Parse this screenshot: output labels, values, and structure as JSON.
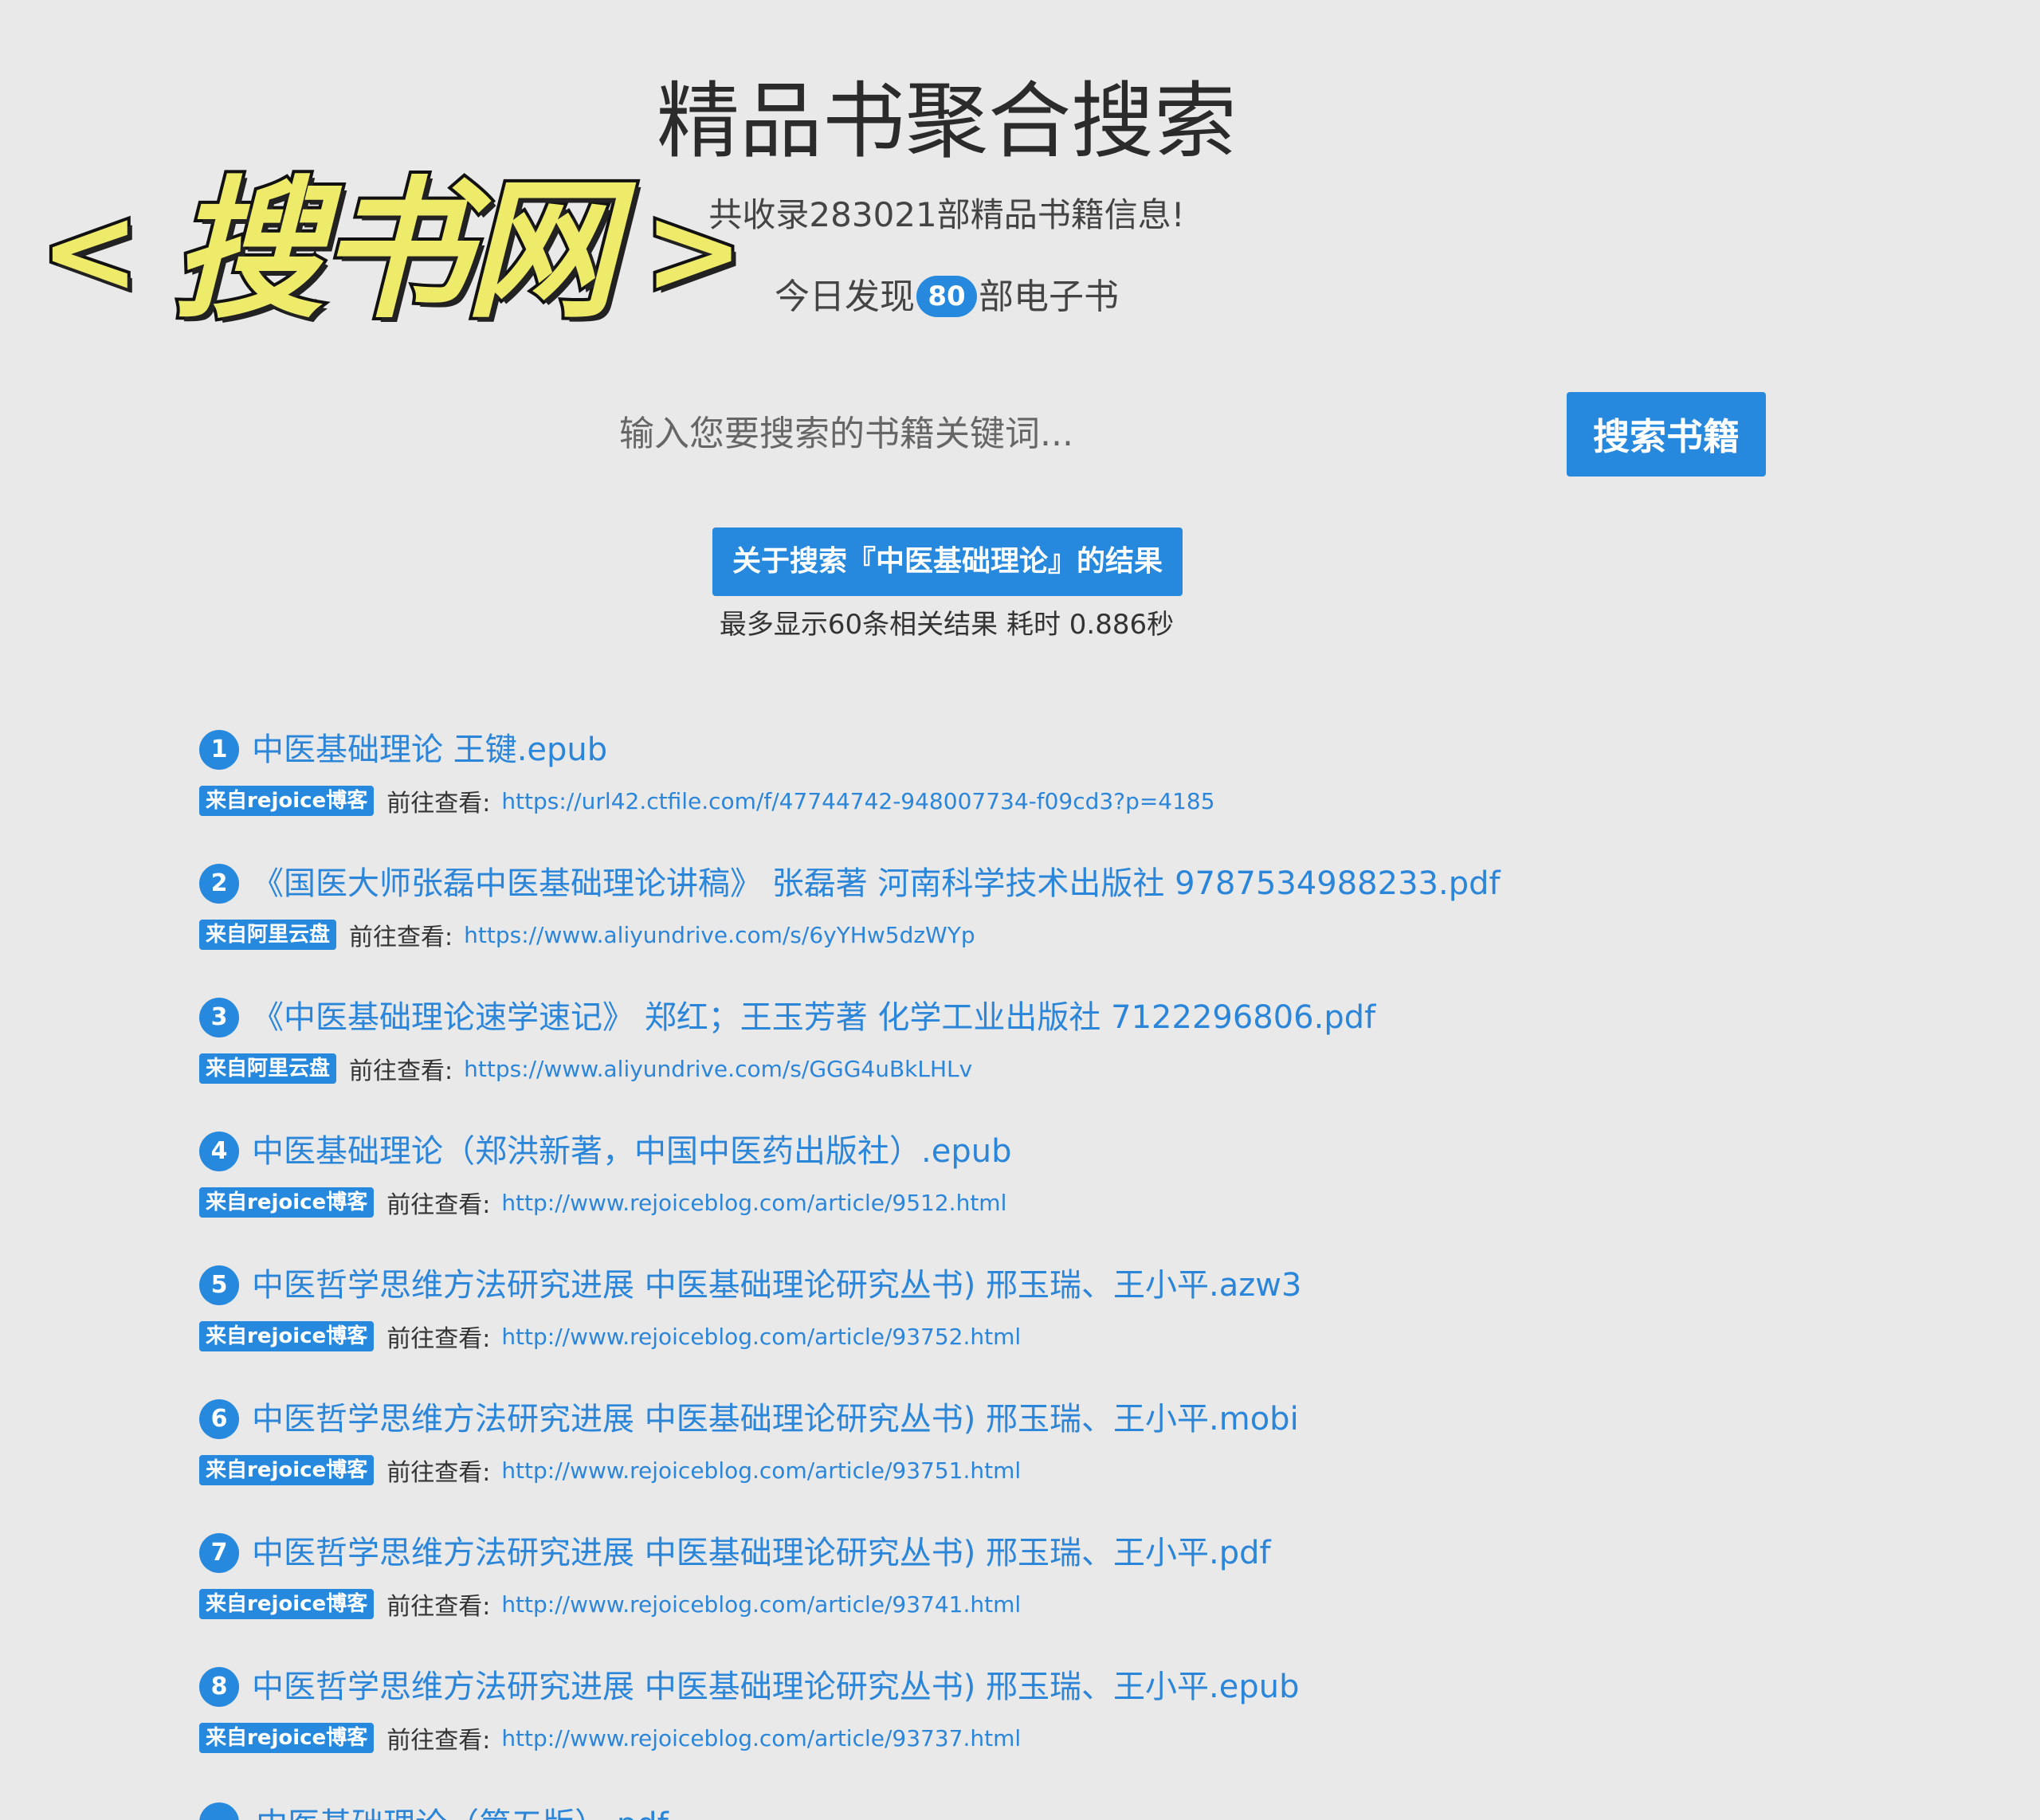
{
  "header": {
    "title": "精品书聚合搜索",
    "subtitle": "共收录283021部精品书籍信息!",
    "today_prefix": "今日发现",
    "today_count": "80",
    "today_suffix": "部电子书"
  },
  "overlay_logo": {
    "left_mark": "<",
    "text": "搜书网",
    "right_mark": ">"
  },
  "search": {
    "placeholder": "输入您要搜索的书籍关键词...",
    "button_label": "搜索书籍"
  },
  "result_summary": {
    "banner": "关于搜索『中医基础理论』的结果",
    "meta": "最多显示60条相关结果 耗时 0.886秒"
  },
  "results": [
    {
      "num": "1",
      "title": "中医基础理论 王键.epub",
      "source": "来自rejoice博客",
      "goto_label": "前往查看:",
      "url": "https://url42.ctfile.com/f/47744742-948007734-f09cd3?p=4185"
    },
    {
      "num": "2",
      "title": "《国医大师张磊中医基础理论讲稿》 张磊著 河南科学技术出版社 9787534988233.pdf",
      "source": "来自阿里云盘",
      "goto_label": "前往查看:",
      "url": "https://www.aliyundrive.com/s/6yYHw5dzWYp"
    },
    {
      "num": "3",
      "title": "《中医基础理论速学速记》 郑红；王玉芳著 化学工业出版社 7122296806.pdf",
      "source": "来自阿里云盘",
      "goto_label": "前往查看:",
      "url": "https://www.aliyundrive.com/s/GGG4uBkLHLv"
    },
    {
      "num": "4",
      "title": "中医基础理论（郑洪新著，中国中医药出版社）.epub",
      "source": "来自rejoice博客",
      "goto_label": "前往查看:",
      "url": "http://www.rejoiceblog.com/article/9512.html"
    },
    {
      "num": "5",
      "title": "中医哲学思维方法研究进展 中医基础理论研究丛书) 邢玉瑞、王小平.azw3",
      "source": "来自rejoice博客",
      "goto_label": "前往查看:",
      "url": "http://www.rejoiceblog.com/article/93752.html"
    },
    {
      "num": "6",
      "title": "中医哲学思维方法研究进展 中医基础理论研究丛书) 邢玉瑞、王小平.mobi",
      "source": "来自rejoice博客",
      "goto_label": "前往查看:",
      "url": "http://www.rejoiceblog.com/article/93751.html"
    },
    {
      "num": "7",
      "title": "中医哲学思维方法研究进展 中医基础理论研究丛书) 邢玉瑞、王小平.pdf",
      "source": "来自rejoice博客",
      "goto_label": "前往查看:",
      "url": "http://www.rejoiceblog.com/article/93741.html"
    },
    {
      "num": "8",
      "title": "中医哲学思维方法研究进展 中医基础理论研究丛书) 邢玉瑞、王小平.epub",
      "source": "来自rejoice博客",
      "goto_label": "前往查看:",
      "url": "http://www.rejoiceblog.com/article/93737.html"
    }
  ],
  "partial_next_result": {
    "title": "中医基础理论（第五版）.pdf"
  },
  "colors": {
    "background": "#e9e9e9",
    "accent": "#2689de",
    "link": "#2b86d9",
    "logo_fill": "#eeea6a"
  }
}
